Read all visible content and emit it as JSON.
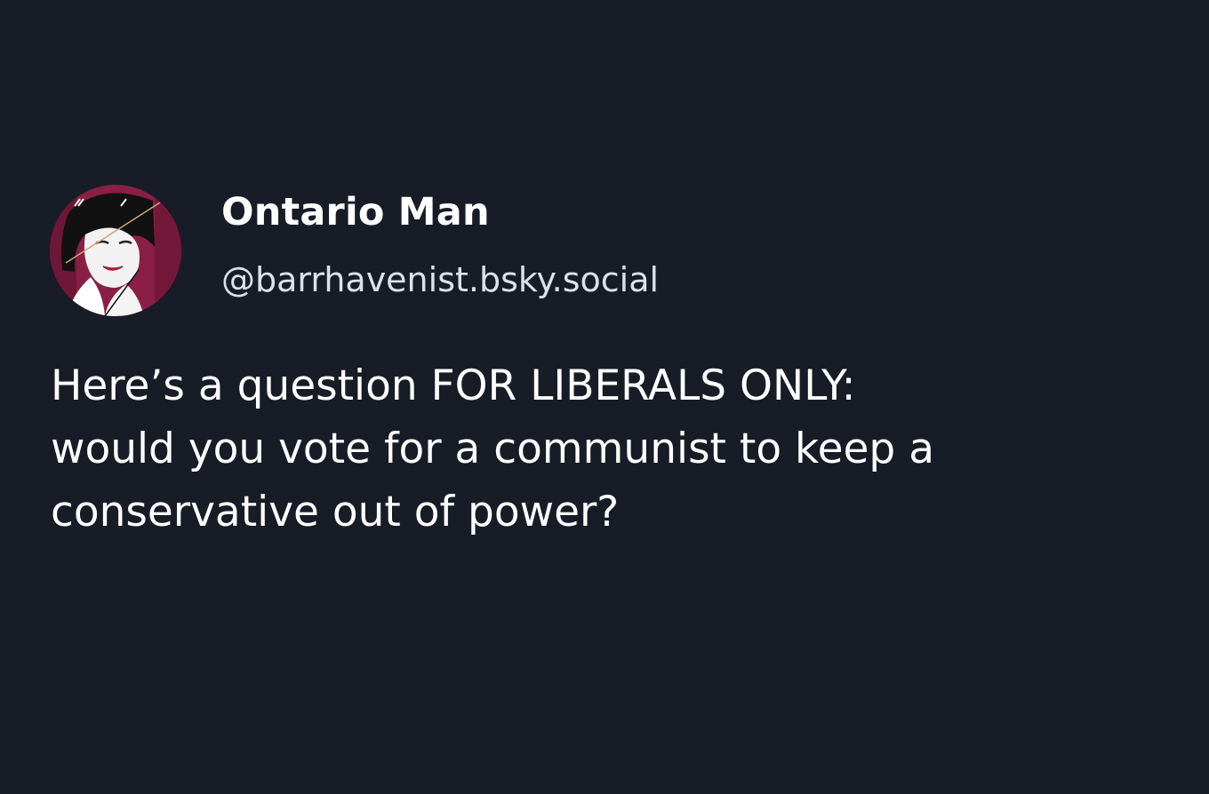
{
  "post": {
    "author": {
      "display_name": "Ontario Man",
      "handle": "@barrhavenist.bsky.social",
      "avatar_icon": "avatar-illustration-icon"
    },
    "text_lines": [
      "Here’s a question FOR LIBERALS ONLY:",
      "would you vote for a communist to keep a",
      "conservative out of power?"
    ]
  },
  "colors": {
    "background": "#181c27",
    "text": "#ffffff",
    "handle": "#dde1e8",
    "avatar_accent": "#8a1f45"
  }
}
